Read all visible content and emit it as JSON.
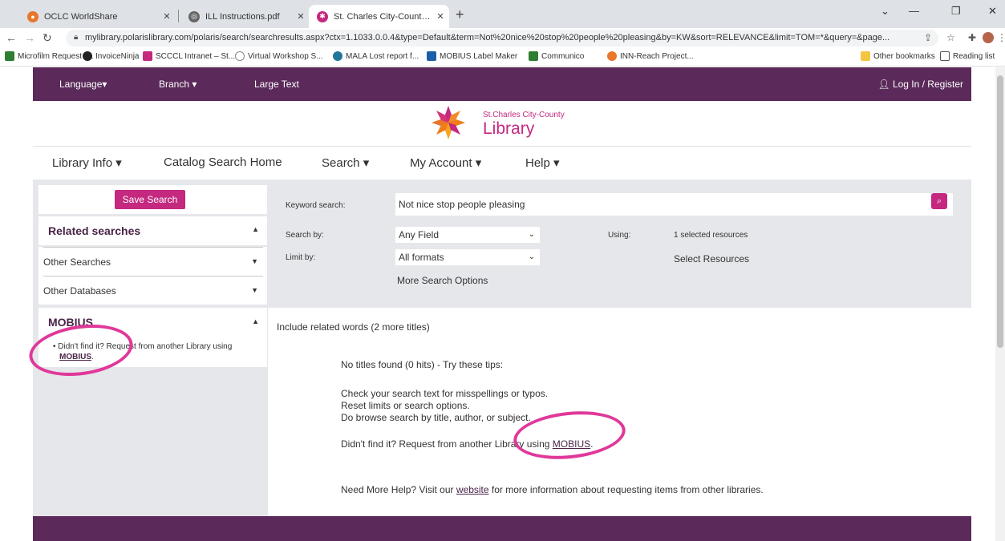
{
  "browser": {
    "tabs": [
      {
        "label": "OCLC WorldShare",
        "close": "✕"
      },
      {
        "label": "ILL Instructions.pdf",
        "close": "✕"
      },
      {
        "label": "St. Charles City-County Library C",
        "close": "✕"
      }
    ],
    "new_tab": "+",
    "url": "mylibrary.polarislibrary.com/polaris/search/searchresults.aspx?ctx=1.1033.0.0.4&type=Default&term=Not%20nice%20stop%20people%20pleasing&by=KW&sort=RELEVANCE&limit=TOM=*&query=&page...",
    "bookmarks": [
      "Microfilm Request (...",
      "InvoiceNinja",
      "SCCCL Intranet – St...",
      "Virtual Workshop S...",
      "MALA Lost report f...",
      "MOBIUS Label Maker",
      "Communico",
      "INN-Reach Project..."
    ],
    "other_bookmarks": "Other bookmarks",
    "reading_list": "Reading list"
  },
  "topnav": {
    "language": "Language▾",
    "branch": "Branch ▾",
    "large_text": "Large Text",
    "login": "Log In / Register"
  },
  "logo": {
    "small": "St.Charles City-County",
    "big": "Library"
  },
  "mainnav": {
    "library_info": "Library Info ▾",
    "catalog_home": "Catalog Search Home",
    "search": "Search ▾",
    "my_account": "My Account ▾",
    "help": "Help ▾"
  },
  "sidebar": {
    "save_search": "Save Search",
    "related_searches": "Related searches",
    "other_searches": "Other Searches",
    "other_databases": "Other Databases",
    "mobius_title": "MOBIUS",
    "mobius_text": "Didn't find it? Request from another Library using",
    "mobius_link": "MOBIUS",
    "mobius_period": "."
  },
  "search": {
    "keyword_label": "Keyword search:",
    "keyword_value": "Not nice stop people pleasing",
    "search_by_label": "Search by:",
    "search_by_value": "Any Field",
    "limit_by_label": "Limit by:",
    "limit_by_value": "All formats",
    "more_options": "More Search Options",
    "using_label": "Using:",
    "using_value": "1 selected resources",
    "select_resources": "Select Resources"
  },
  "results": {
    "related_words": "Include related words (2 more titles)",
    "no_titles": "No titles found (0 hits) - Try these tips:",
    "tip1": "Check your search text for misspellings or typos.",
    "tip2": "Reset limits or search options.",
    "tip3": "Do browse search by title, author, or subject.",
    "didnt_find": "Didn't find it? Request from another Library using",
    "mobius_link": "MOBIUS",
    "period": ".",
    "help_pre": "Need More Help? Visit our",
    "website_link": "website",
    "help_post": "for more information about requesting items from other libraries."
  },
  "colors": {
    "brand_purple": "#5b2a5a",
    "accent_pink": "#c4287f",
    "annotation_circle": "#e0389a"
  }
}
